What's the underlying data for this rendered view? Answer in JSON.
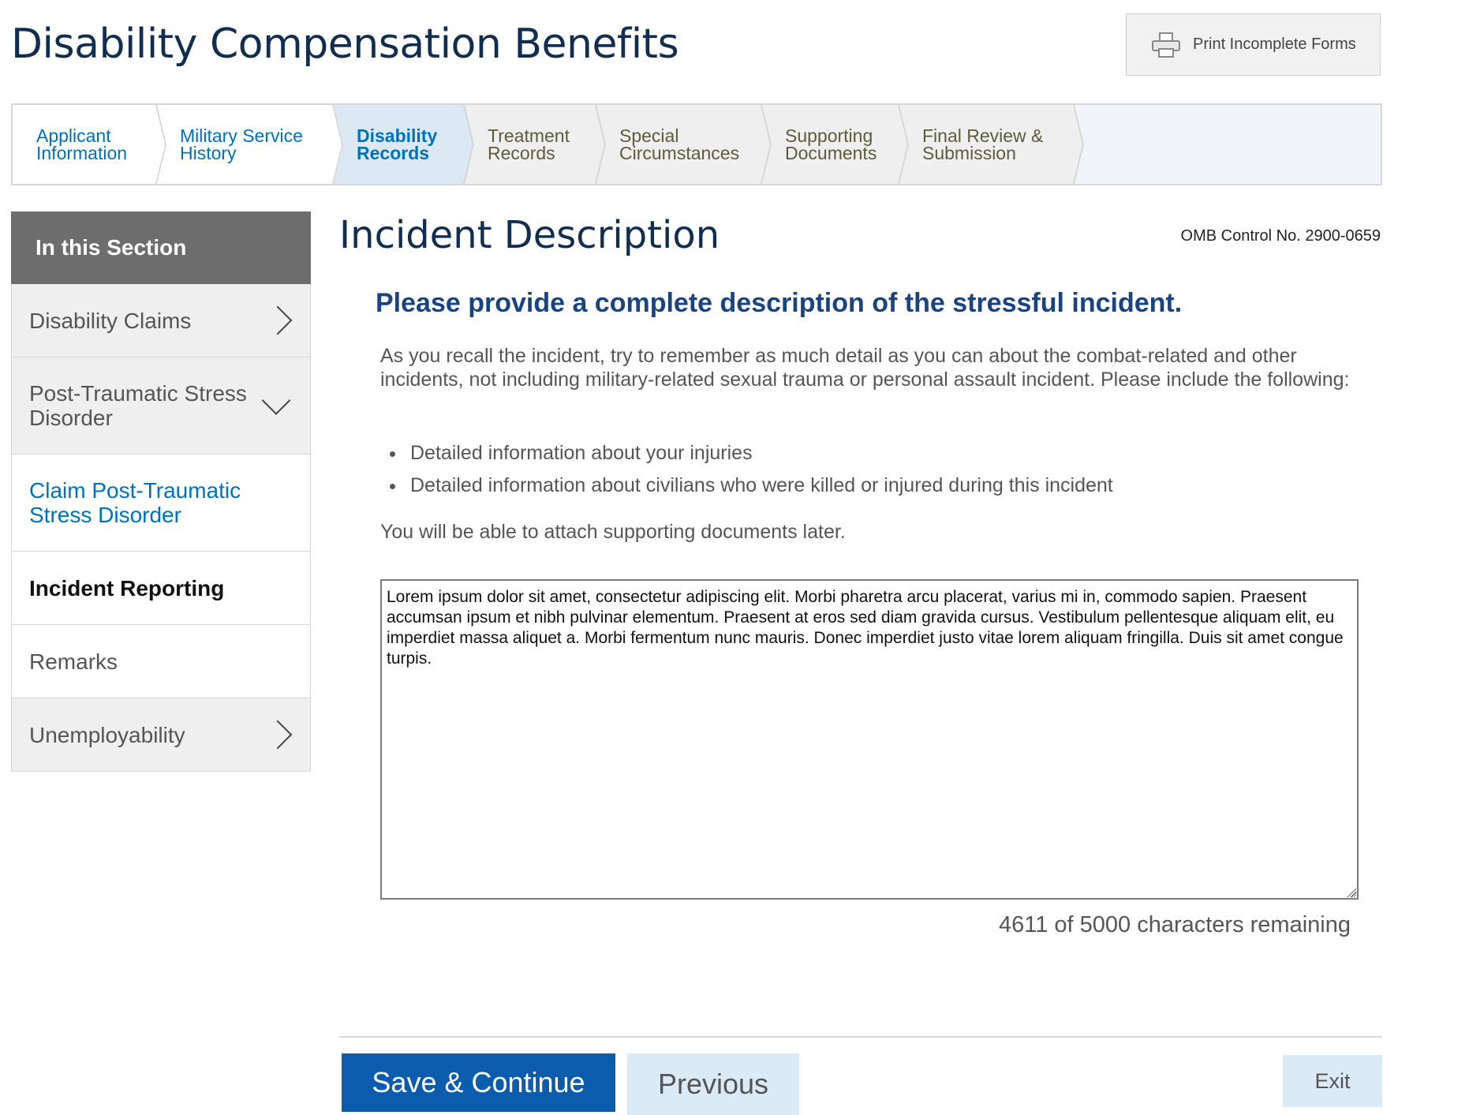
{
  "header": {
    "title": "Disability Compensation Benefits",
    "print_button_label": "Print Incomplete Forms"
  },
  "steps": [
    {
      "label": "Applicant\nInformation",
      "state": "done"
    },
    {
      "label": "Military Service\nHistory",
      "state": "done"
    },
    {
      "label": "Disability\nRecords",
      "state": "active"
    },
    {
      "label": "Treatment\nRecords",
      "state": "todo"
    },
    {
      "label": "Special\nCircumstances",
      "state": "todo"
    },
    {
      "label": "Supporting\nDocuments",
      "state": "todo"
    },
    {
      "label": "Final Review &\nSubmission",
      "state": "todo"
    }
  ],
  "sidebar": {
    "heading": "In this Section",
    "items": [
      {
        "label": "Disability Claims"
      },
      {
        "label": "Post-Traumatic Stress Disorder"
      },
      {
        "label": "Claim Post-Traumatic Stress Disorder"
      },
      {
        "label": "Incident Reporting"
      },
      {
        "label": "Remarks"
      },
      {
        "label": "Unemployability"
      }
    ]
  },
  "main": {
    "section_title": "Incident Description",
    "omb": "OMB Control No. 2900-0659",
    "question": "Please provide a complete description of the stressful incident.",
    "instructions": "As you recall the incident, try to remember as much detail as you can about the combat-related and other incidents, not including military-related sexual trauma or personal assault incident. Please include the following:",
    "bullets": [
      "Detailed information about your injuries",
      "Detailed information about civilians who were killed or injured during this incident"
    ],
    "attach_note": "You will be able to attach supporting documents later.",
    "description_value": "Lorem ipsum dolor sit amet, consectetur adipiscing elit. Morbi pharetra arcu placerat, varius mi in, commodo sapien. Praesent accumsan ipsum et nibh pulvinar elementum. Praesent at eros sed diam gravida cursus. Vestibulum pellentesque aliquam elit, eu imperdiet massa aliquet a. Morbi fermentum nunc mauris. Donec imperdiet justo vitae lorem aliquam fringilla. Duis sit amet congue turpis.",
    "char_count": "4611 of 5000 characters remaining"
  },
  "footer": {
    "save_label": "Save & Continue",
    "previous_label": "Previous",
    "exit_label": "Exit"
  },
  "colors": {
    "primary": "#0b5cad",
    "title_navy": "#112e51",
    "link_blue": "#0071bb",
    "sidebar_head": "#6d6d6d"
  }
}
